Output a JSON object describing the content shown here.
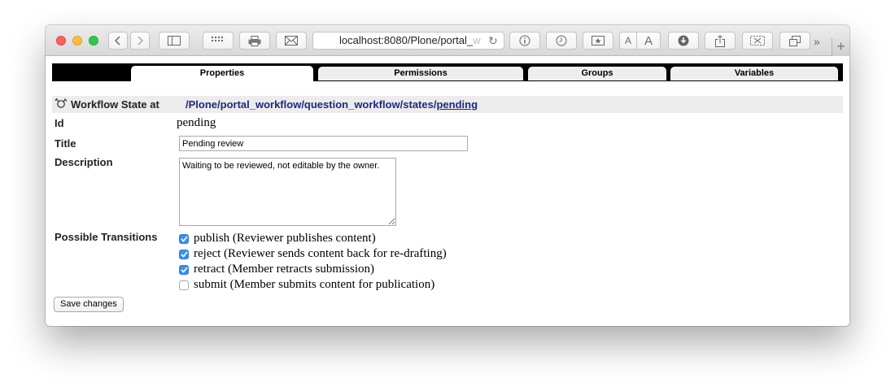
{
  "browser": {
    "url_host": "localhost:8080/Plone/portal_",
    "url_fade": "w"
  },
  "tabs": [
    {
      "label": "Properties",
      "active": true
    },
    {
      "label": "Permissions",
      "active": false
    },
    {
      "label": "Groups",
      "active": false
    },
    {
      "label": "Variables",
      "active": false
    }
  ],
  "header": {
    "label": "Workflow State at",
    "path": [
      {
        "label": "/Plone"
      },
      {
        "label": "/portal_workflow"
      },
      {
        "label": "/question_workflow"
      },
      {
        "label": "/states"
      },
      {
        "label": "pending"
      }
    ]
  },
  "form": {
    "id_label": "Id",
    "id_value": "pending",
    "title_label": "Title",
    "title_value": "Pending review",
    "description_label": "Description",
    "description_value": "Waiting to be reviewed, not editable by the owner.",
    "transitions_label": "Possible Transitions",
    "transitions": [
      {
        "label": "publish (Reviewer publishes content)",
        "checked": true
      },
      {
        "label": "reject (Reviewer sends content back for re-drafting)",
        "checked": true
      },
      {
        "label": "retract (Member retracts submission)",
        "checked": true
      },
      {
        "label": "submit (Member submits content for publication)",
        "checked": false
      }
    ],
    "save_label": "Save changes"
  },
  "colors": {
    "checkbox_checked": "#3b8ef0",
    "path_link": "#1b2a7a",
    "tab_bar": "#000000"
  }
}
